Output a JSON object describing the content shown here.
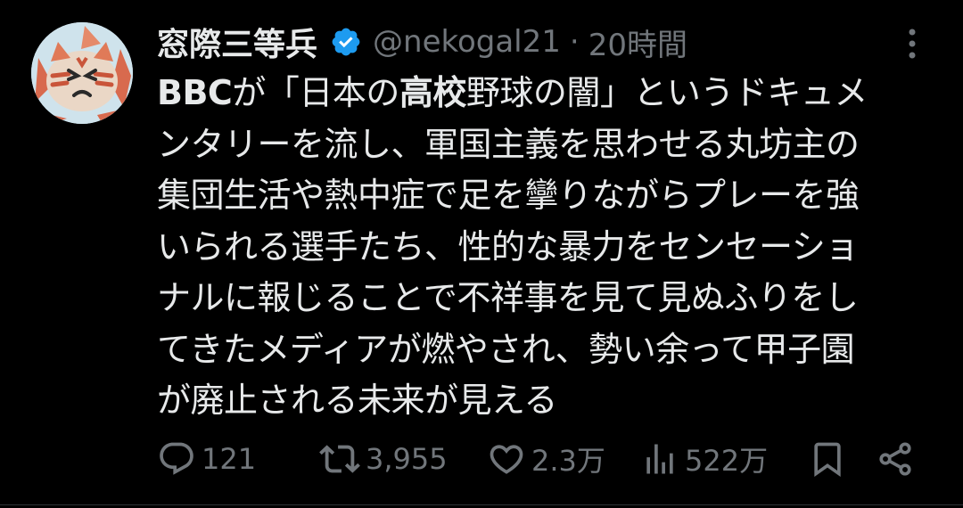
{
  "author": {
    "display_name": "窓際三等兵",
    "handle": "@nekogal21",
    "separator": "·",
    "time": "20時間"
  },
  "tweet": {
    "lines": [
      [
        "BBC",
        "が「日本の",
        "高校",
        "野球の闇」というドキュメ"
      ],
      "ンタリーを流し、軍国主義を思わせる丸坊主の",
      "集団生活や熱中症で足を攣りながらプレーを強",
      "いられる選手たち、性的な暴力をセンセーショ",
      "ナルに報じることで不祥事を見て見ぬふりをし",
      "てきたメディアが燃やされ、勢い余って甲子園",
      "が廃止される未来が見える"
    ]
  },
  "actions": {
    "reply_count": "121",
    "retweet_count": "3,955",
    "like_count": "2.3万",
    "view_count": "522万"
  },
  "icons": [
    "verified-badge-icon",
    "more-options-icon",
    "reply-icon",
    "retweet-icon",
    "like-icon",
    "views-icon",
    "bookmark-icon",
    "share-icon"
  ],
  "colors": {
    "background": "#000000",
    "text": "#e7e9ea",
    "muted": "#71767b",
    "verified": "#1d9bf0"
  }
}
